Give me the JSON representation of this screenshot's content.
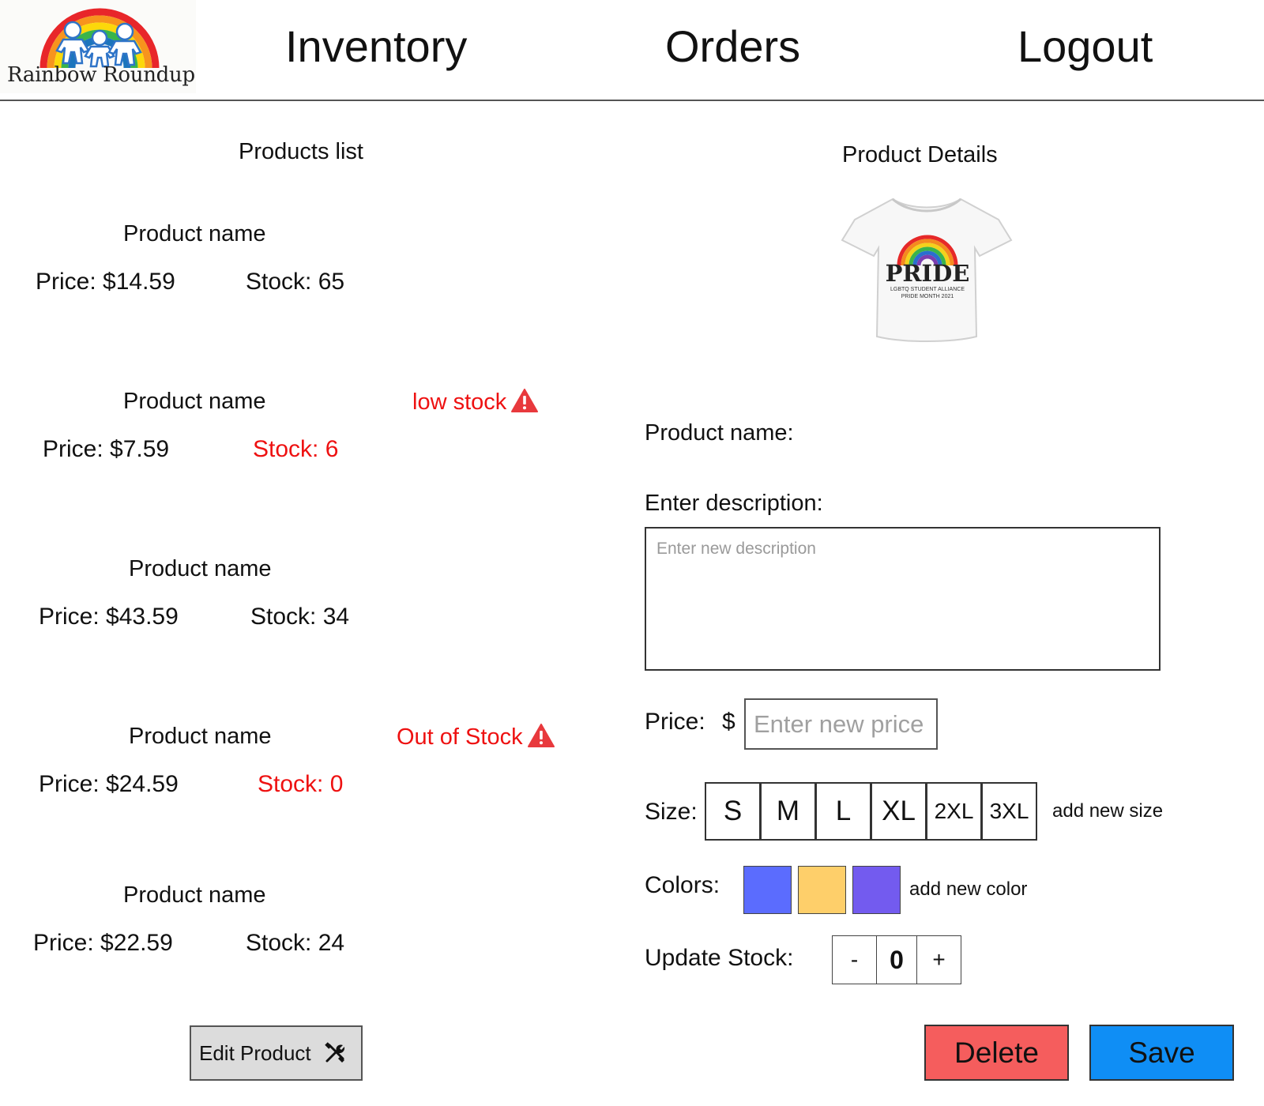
{
  "header": {
    "logo_text": "Rainbow Roundup",
    "nav": {
      "inventory": "Inventory",
      "orders": "Orders",
      "logout": "Logout"
    }
  },
  "products": {
    "title": "Products list",
    "items": [
      {
        "name": "Product name",
        "price": "Price: $14.59",
        "stock": "Stock: 65",
        "alert": "",
        "status": "normal"
      },
      {
        "name": "Product name",
        "price": "Price: $7.59",
        "stock": "Stock: 6",
        "alert": "low stock",
        "status": "low"
      },
      {
        "name": "Product name",
        "price": "Price: $43.59",
        "stock": "Stock: 34",
        "alert": "",
        "status": "normal"
      },
      {
        "name": "Product name",
        "price": "Price: $24.59",
        "stock": "Stock: 0",
        "alert": "Out of Stock",
        "status": "out"
      },
      {
        "name": "Product name",
        "price": "Price: $22.59",
        "stock": "Stock: 24",
        "alert": "",
        "status": "normal"
      }
    ],
    "edit_button": "Edit Product",
    "edit_icon": "tools-icon",
    "alert_icon": "warning-triangle-icon",
    "alert_color": "#ee1111"
  },
  "details": {
    "title": "Product Details",
    "image_shirt_text": "PRIDE",
    "image_shirt_subtext_1": "LGBTQ STUDENT ALLIANCE",
    "image_shirt_subtext_2": "PRIDE MONTH 2021",
    "name_label": "Product name:",
    "description_label": "Enter description:",
    "description_placeholder": "Enter new description",
    "price_label": "Price:",
    "currency": "$",
    "price_placeholder": "Enter new price",
    "size_label": "Size:",
    "sizes": [
      "S",
      "M",
      "L",
      "XL",
      "2XL",
      "3XL"
    ],
    "add_size": "add new size",
    "colors_label": "Colors:",
    "colors": [
      "#5b6cfe",
      "#fecf6a",
      "#735bef"
    ],
    "add_color": "add new color",
    "stock_label": "Update Stock:",
    "stock_minus": "-",
    "stock_value": "0",
    "stock_plus": "+",
    "delete_button": "Delete",
    "save_button": "Save",
    "delete_color": "#f55d5d",
    "save_color": "#0f8ef5"
  }
}
